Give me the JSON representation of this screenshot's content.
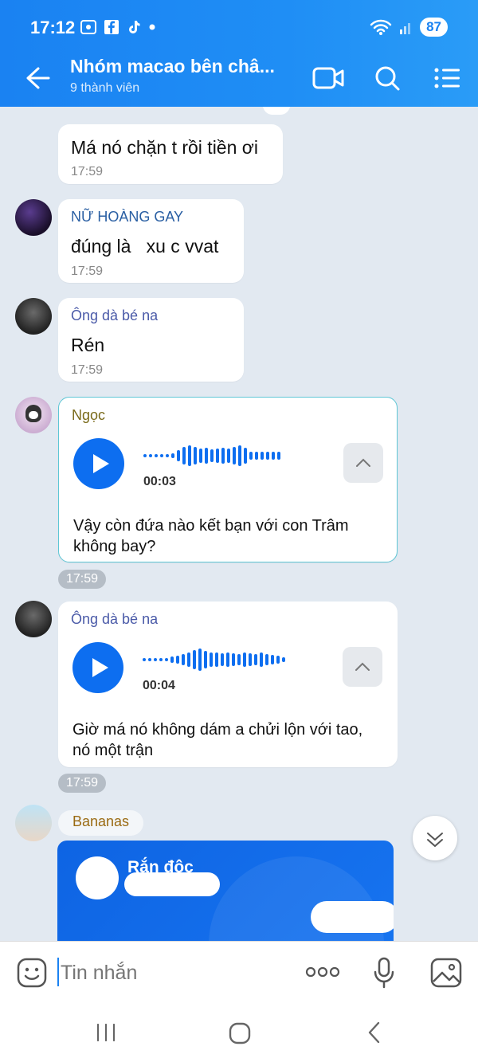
{
  "status_bar": {
    "time": "17:12",
    "battery": "87"
  },
  "header": {
    "title": "Nhóm macao bên châ...",
    "subtitle": "9 thành viên"
  },
  "messages": [
    {
      "text": "Má nó chặn t rồi tiền ơi",
      "time": "17:59"
    },
    {
      "sender": "NỮ HOÀNG GAY",
      "text": "đúng là   xu c vvat",
      "time": "17:59"
    },
    {
      "sender": "Ông dà bé na",
      "text": "Rén",
      "time": "17:59"
    },
    {
      "sender": "Ngọc",
      "duration": "00:03",
      "text": "Vậy còn đứa nào kết bạn với con Trâm không bay?",
      "time": "17:59"
    },
    {
      "sender": "Ông dà bé na",
      "duration": "00:04",
      "text": "Giờ má nó không dám a chửi lộn với tao, nó một trận",
      "time": "17:59"
    },
    {
      "sender": "Bananas",
      "card_name": "Rắn độc"
    }
  ],
  "input": {
    "placeholder": "Tin nhắn"
  },
  "icons": {
    "back": "back-arrow-icon",
    "video": "video-call-icon",
    "search": "search-icon",
    "menu": "menu-list-icon",
    "emoji": "emoji-icon",
    "more": "more-icon",
    "mic": "mic-icon",
    "image": "image-icon"
  },
  "colors": {
    "header_blue": "#1a82f2",
    "play_blue": "#0d6ef0",
    "chat_bg": "#e2e9f1",
    "voice_border": "#5ec6d5"
  }
}
